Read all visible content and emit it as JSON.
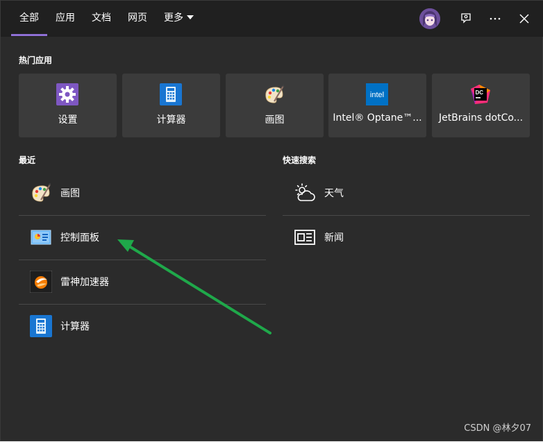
{
  "tabs": [
    {
      "label": "全部",
      "active": true
    },
    {
      "label": "应用"
    },
    {
      "label": "文档"
    },
    {
      "label": "网页"
    },
    {
      "label": "更多"
    }
  ],
  "hot_apps": {
    "title": "热门应用",
    "items": [
      {
        "label": "设置",
        "icon": "gear-icon"
      },
      {
        "label": "计算器",
        "icon": "calculator-icon"
      },
      {
        "label": "画图",
        "icon": "paint-palette-icon"
      },
      {
        "label": "Intel® Optane™...",
        "icon": "intel-logo-icon"
      },
      {
        "label": "JetBrains dotCo...",
        "icon": "dotcover-icon"
      }
    ]
  },
  "recent": {
    "title": "最近",
    "items": [
      {
        "label": "画图",
        "icon": "paint-palette-icon"
      },
      {
        "label": "控制面板",
        "icon": "control-panel-icon"
      },
      {
        "label": "雷神加速器",
        "icon": "leishen-accelerator-icon"
      },
      {
        "label": "计算器",
        "icon": "calculator-icon"
      }
    ]
  },
  "quick_search": {
    "title": "快速搜索",
    "items": [
      {
        "label": "天气",
        "icon": "weather-icon"
      },
      {
        "label": "新闻",
        "icon": "news-icon"
      }
    ]
  },
  "colors": {
    "accent": "#8f70d6",
    "arrow": "#1fa84a",
    "panel_bg": "#2b2b2b",
    "tile_bg": "#3b3b3b"
  },
  "watermark": "CSDN @林夕07"
}
